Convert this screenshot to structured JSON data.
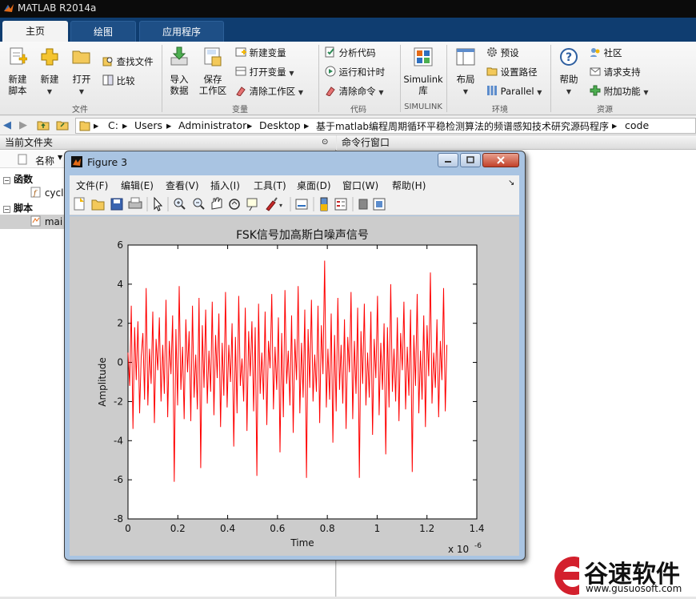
{
  "app": {
    "title": "MATLAB R2014a"
  },
  "tabs": [
    {
      "label": "主页"
    },
    {
      "label": "绘图"
    },
    {
      "label": "应用程序"
    }
  ],
  "ribbon": {
    "new_script": [
      "新建",
      "脚本"
    ],
    "new": "新建",
    "open": "打开",
    "find_files": "查找文件",
    "compare": "比较",
    "import": [
      "导入",
      "数据"
    ],
    "save_ws": [
      "保存",
      "工作区"
    ],
    "new_var": "新建变量",
    "open_var": "打开变量",
    "clear_ws": "清除工作区",
    "analyze": "分析代码",
    "run_time": "运行和计时",
    "clear_cmd": "清除命令",
    "simulink": [
      "Simulink",
      "库"
    ],
    "layout": "布局",
    "prefs": "预设",
    "set_path": "设置路径",
    "parallel": "Parallel",
    "help": "帮助",
    "community": "社区",
    "request_support": "请求支持",
    "addons": "附加功能",
    "groups": {
      "file": "文件",
      "variable": "变量",
      "code": "代码",
      "simulink": "SIMULINK",
      "environment": "环境",
      "resources": "资源"
    }
  },
  "address": {
    "crumbs": [
      "C:",
      "Users",
      "Administrator",
      "Desktop",
      "基于matlab编程周期循环平稳检测算法的频谱感知技术研究源码程序",
      "code"
    ]
  },
  "left_panel": {
    "title": "当前文件夹",
    "column": "名称",
    "sections": [
      {
        "label": "函数",
        "items": [
          "cycl"
        ]
      },
      {
        "label": "脚本",
        "items": [
          "mai"
        ]
      }
    ]
  },
  "right_panel": {
    "title": "命令行窗口"
  },
  "figure": {
    "title": "Figure 3",
    "menus": [
      "文件(F)",
      "编辑(E)",
      "查看(V)",
      "插入(I)",
      "工具(T)",
      "桌面(D)",
      "窗口(W)",
      "帮助(H)"
    ]
  },
  "chart_data": {
    "type": "line",
    "title": "FSK信号加高斯白噪声信号",
    "xlabel": "Time",
    "ylabel": "Amplitude",
    "xlim": [
      0,
      1.4
    ],
    "ylim": [
      -8,
      6
    ],
    "x_multiplier": "x 10",
    "x_exponent": "-6",
    "x_ticks": [
      "0",
      "0.2",
      "0.4",
      "0.6",
      "0.8",
      "1",
      "1.2",
      "1.4"
    ],
    "y_ticks": [
      "6",
      "4",
      "2",
      "0",
      "-2",
      "-4",
      "-6",
      "-8"
    ],
    "grid": false,
    "series": [
      {
        "color": "#ff0000",
        "x_start": 0,
        "x_end": 1.28,
        "values": [
          0.5,
          -1.2,
          2.9,
          -3.4,
          1.8,
          -0.9,
          2.1,
          -2.6,
          0.3,
          1.5,
          -1.9,
          3.8,
          -2.2,
          0.7,
          -1.1,
          2.6,
          -3.1,
          1.2,
          -0.4,
          2.3,
          -2.0,
          0.9,
          -1.6,
          3.2,
          -2.8,
          1.1,
          -0.6,
          2.4,
          -6.1,
          1.7,
          -2.2,
          3.9,
          -1.4,
          0.8,
          -2.9,
          2.2,
          -0.5,
          1.6,
          -3.0,
          2.9,
          -1.8,
          0.4,
          -2.4,
          3.3,
          -5.4,
          1.9,
          -1.3,
          2.7,
          -2.1,
          0.6,
          -1.5,
          3.1,
          -2.7,
          1.4,
          -0.8,
          2.5,
          -3.3,
          1.0,
          -1.7,
          3.6,
          -2.3,
          0.9,
          -1.0,
          2.0,
          -4.3,
          1.3,
          -2.6,
          3.4,
          -1.2,
          0.2,
          -2.0,
          2.8,
          -3.5,
          1.6,
          -0.7,
          2.1,
          -2.5,
          1.8,
          -5.8,
          3.0,
          -1.6,
          0.5,
          -1.9,
          2.6,
          -3.2,
          1.1,
          -0.3,
          3.5,
          -2.4,
          0.8,
          -1.4,
          2.3,
          -4.6,
          1.5,
          -2.8,
          3.7,
          -1.1,
          0.6,
          -2.2,
          2.4,
          -3.6,
          1.2,
          -0.9,
          3.9,
          -2.6,
          1.0,
          -1.8,
          2.7,
          -5.9,
          1.7,
          -1.3,
          3.2,
          -2.0,
          0.4,
          -1.5,
          2.9,
          -3.1,
          1.9,
          -0.6,
          5.2,
          -2.3,
          0.7,
          -1.9,
          2.5,
          -4.1,
          1.4,
          -2.5,
          3.3,
          -1.4,
          0.9,
          -2.1,
          2.2,
          -3.4,
          1.3,
          -0.5,
          3.6,
          -2.9,
          1.1,
          -1.6,
          2.8,
          -5.9,
          1.6,
          -1.1,
          3.0,
          -2.2,
          0.5,
          -1.8,
          2.6,
          -3.7,
          1.2,
          -0.8,
          3.4,
          -2.7,
          1.0,
          -1.4,
          2.0,
          -4.7,
          1.8,
          -2.3,
          4.0,
          -1.5,
          0.7,
          -2.0,
          2.3,
          -3.0,
          1.5,
          -0.4,
          3.1,
          -2.4,
          0.8,
          -1.7,
          2.7,
          -5.6,
          1.4,
          -1.2,
          3.5,
          -2.6,
          0.6,
          -1.9,
          2.4,
          -3.3,
          1.9,
          -0.7,
          4.6,
          -2.1,
          0.5,
          -1.3,
          2.2,
          -2.8,
          1.1,
          -0.9,
          3.8,
          -2.5,
          0.9
        ]
      }
    ]
  },
  "watermark": {
    "brand": "谷速软件",
    "url": "www.gusuosoft.com"
  }
}
